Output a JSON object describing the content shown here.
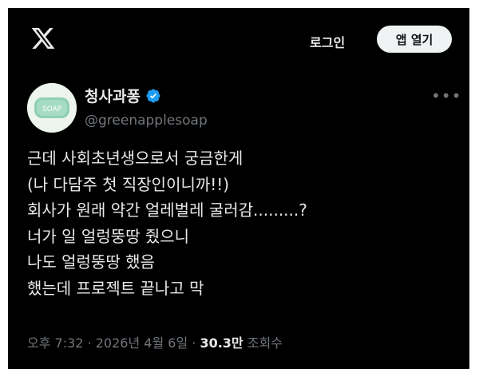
{
  "header": {
    "logo_icon": "x-logo-icon",
    "login_label": "로그인",
    "open_app_label": "앱 열기"
  },
  "author": {
    "display_name": "청사과퐁",
    "verified_icon": "verified-badge-icon",
    "handle": "@greenapplesoap",
    "avatar_text": "SOAP",
    "avatar_color": "#8fd0b0"
  },
  "tweet": {
    "lines": [
      "근데 사회초년생으로서 궁금한게",
      "(나 다담주 첫 직장인이니까!!)",
      "회사가 원래 약간 얼레벌레 굴러감.........?",
      "너가 일 얼렁뚱땅 줬으니",
      "나도 얼렁뚱땅 했음",
      "했는데 프로젝트 끝나고 막"
    ]
  },
  "meta": {
    "time": "오후 7:32",
    "date": "2026년 4월 6일",
    "views_count": "30.3만",
    "views_label": "조회수",
    "separator": "·"
  },
  "colors": {
    "background": "#000000",
    "text": "#e7e9ea",
    "muted": "#71767b",
    "verified_blue": "#1d9bf0"
  }
}
